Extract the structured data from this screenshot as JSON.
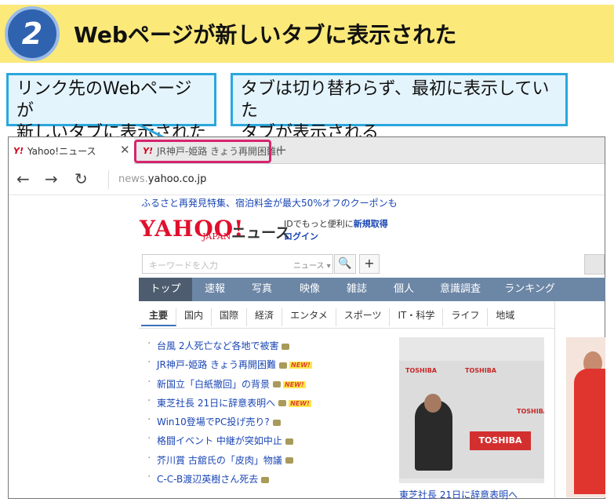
{
  "step": {
    "number": "2",
    "title": "Webページが新しいタブに表示された"
  },
  "callouts": {
    "left": [
      "リンク先のWebページが",
      "新しいタブに表示された"
    ],
    "right": [
      "タブは切り替わらず、最初に表示していた",
      "タブが表示される"
    ]
  },
  "browser": {
    "tabs": [
      {
        "label": "Yahoo!ニュース",
        "favicon": "Y!"
      },
      {
        "label": "JR神戸-姫路 きょう再開困難(",
        "favicon": "Y!"
      }
    ],
    "tab_close": "✕",
    "new_tab": "+",
    "nav": {
      "back": "←",
      "forward": "→",
      "reload": "↻"
    },
    "address": {
      "prefix": "news.",
      "domain": "yahoo.co.jp"
    }
  },
  "yahoo": {
    "promo": "ふるさと再発見特集、宿泊料金が最大50%オフのクーポンも",
    "logo": "YAHOO!",
    "logo_sub": "JAPAN",
    "logo_news": "ニュース",
    "login_line1": "IDでもっと便利に",
    "login_register": "新規取得",
    "login_link": "ログイン",
    "search_placeholder": "キーワードを入力",
    "search_scope": "ニュース ▾",
    "search_icon": "🔍",
    "plus": "+",
    "main_nav": [
      "トップ",
      "速報",
      "写真",
      "映像",
      "雑誌",
      "個人",
      "意識調査",
      "ランキング"
    ],
    "sub_nav": [
      "主要",
      "国内",
      "国際",
      "経済",
      "エンタメ",
      "スポーツ",
      "IT・科学",
      "ライフ",
      "地域"
    ],
    "headlines": [
      {
        "text": "台風 2人死亡など各地で被害",
        "new": false
      },
      {
        "text": "JR神戸-姫路 きょう再開困難",
        "new": true
      },
      {
        "text": "新国立「白紙撤回」の背景",
        "new": true
      },
      {
        "text": "東芝社長 21日に辞意表明へ",
        "new": true
      },
      {
        "text": "Win10登場でPC投げ売り?",
        "new": false
      },
      {
        "text": "格闘イベント 中継が突如中止",
        "new": false
      },
      {
        "text": "芥川賞 古舘氏の「皮肉」物議",
        "new": false
      },
      {
        "text": "C-C-B渡辺英樹さん死去",
        "new": false
      }
    ],
    "new_badge": "NEW!",
    "photo_brand": "TOSHIBA",
    "photo_caption": "東芝社長 21日に辞意表明へ"
  },
  "colors": {
    "accent_blue": "#2aa7dd",
    "highlight_magenta": "#d6246e",
    "yahoo_red": "#e0102c",
    "nav_bg": "#6c86a6"
  }
}
